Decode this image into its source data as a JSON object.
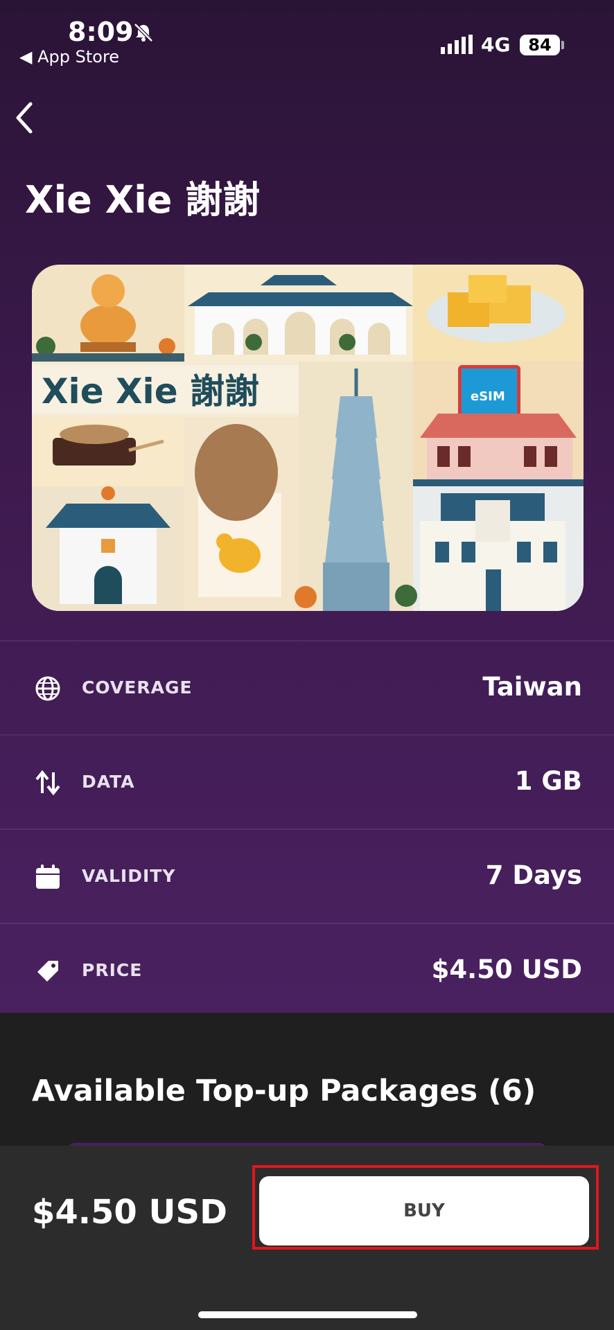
{
  "status_bar": {
    "time": "8:09",
    "back_app": "App Store",
    "network": "4G",
    "battery": "84"
  },
  "header": {
    "title": "Xie Xie 謝謝"
  },
  "card": {
    "brand_text": "Xie Xie 謝謝",
    "chip_label": "eSIM"
  },
  "details": [
    {
      "icon": "globe-icon",
      "label": "COVERAGE",
      "value": "Taiwan"
    },
    {
      "icon": "up-down-arrows-icon",
      "label": "DATA",
      "value": "1 GB"
    },
    {
      "icon": "calendar-icon",
      "label": "VALIDITY",
      "value": "7 Days"
    },
    {
      "icon": "tag-icon",
      "label": "PRICE",
      "value": "$4.50 USD"
    }
  ],
  "topup": {
    "title": "Available Top-up Packages (6)"
  },
  "footer": {
    "price": "$4.50 USD",
    "buy_label": "BUY",
    "highlight_color": "#e0161e"
  },
  "colors": {
    "bg_top": "#2a1436",
    "bg_bottom": "#4a2160",
    "dark_panel": "#1f1f1f",
    "footer": "#2c2c2c"
  }
}
